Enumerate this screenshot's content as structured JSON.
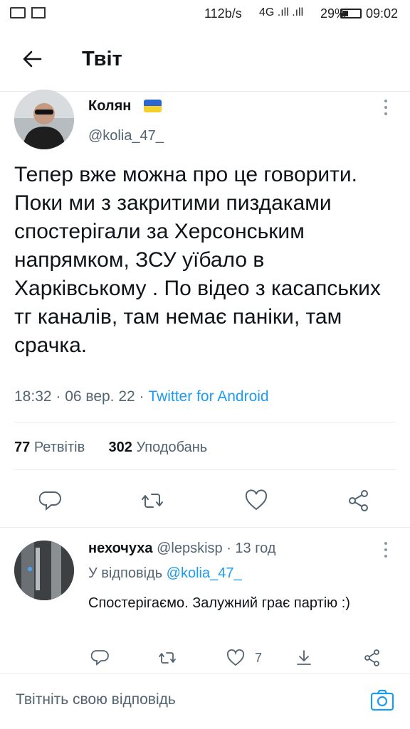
{
  "status_bar": {
    "net_speed": "112b/s",
    "signal": "4G .ıll .ıll",
    "battery": "29%",
    "time": "09:02"
  },
  "header": {
    "title": "Твіт"
  },
  "tweet": {
    "author_name": "Колян",
    "author_handle": "@kolia_47_",
    "text": "Тепер вже можна про це говорити. Поки ми з закритими пиздаками спостерігали за Херсонським напрямком, ЗСУ уїбало в Харківському .  По відео з касапських тг каналів, там немає паніки, там срачка.",
    "time": "18:32 · 06 вер. 22 · ",
    "source": "Twitter for Android",
    "retweets_count": "77",
    "retweets_label": "Ретвітів",
    "likes_count": "302",
    "likes_label": "Уподобань"
  },
  "reply": {
    "author_name": "нехочуха",
    "author_handle": "@lepskisp",
    "time": " · 13 год",
    "reply_to_label": "У відповідь ",
    "reply_to_handle": "@kolia_47_",
    "text": "Спостерігаємо. Залужний грає партію :)",
    "likes": "7"
  },
  "compose": {
    "placeholder": "Твітніть свою відповідь"
  },
  "colors": {
    "accent": "#1d9bf0",
    "text": "#0f1419",
    "muted": "#536471"
  }
}
